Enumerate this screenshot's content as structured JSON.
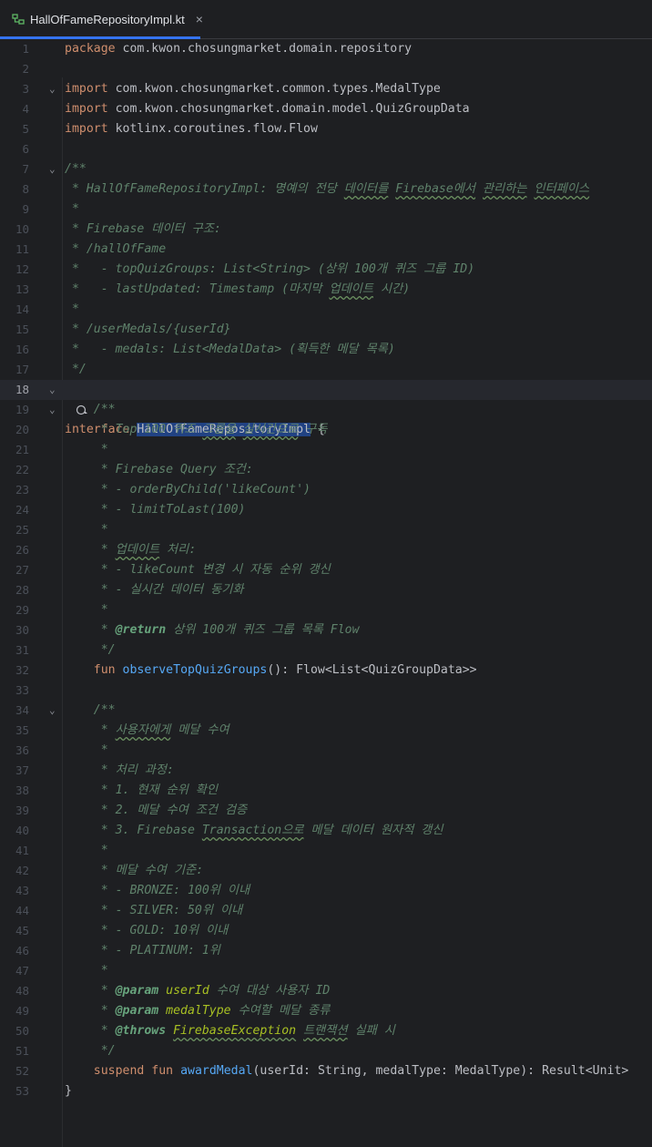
{
  "tab": {
    "title": "HallOfFameRepositoryImpl.kt",
    "close": "×"
  },
  "lines": [
    {
      "n": "1"
    },
    {
      "n": "2"
    },
    {
      "n": "3"
    },
    {
      "n": "4"
    },
    {
      "n": "5"
    },
    {
      "n": "6"
    },
    {
      "n": "7"
    },
    {
      "n": "8"
    },
    {
      "n": "9"
    },
    {
      "n": "10"
    },
    {
      "n": "11"
    },
    {
      "n": "12"
    },
    {
      "n": "13"
    },
    {
      "n": "14"
    },
    {
      "n": "15"
    },
    {
      "n": "16"
    },
    {
      "n": "17"
    },
    {
      "n": "18"
    },
    {
      "n": "19"
    },
    {
      "n": "20"
    },
    {
      "n": "21"
    },
    {
      "n": "22"
    },
    {
      "n": "23"
    },
    {
      "n": "24"
    },
    {
      "n": "25"
    },
    {
      "n": "26"
    },
    {
      "n": "27"
    },
    {
      "n": "28"
    },
    {
      "n": "29"
    },
    {
      "n": "30"
    },
    {
      "n": "31"
    },
    {
      "n": "32"
    },
    {
      "n": "33"
    },
    {
      "n": "34"
    },
    {
      "n": "35"
    },
    {
      "n": "36"
    },
    {
      "n": "37"
    },
    {
      "n": "38"
    },
    {
      "n": "39"
    },
    {
      "n": "40"
    },
    {
      "n": "41"
    },
    {
      "n": "42"
    },
    {
      "n": "43"
    },
    {
      "n": "44"
    },
    {
      "n": "45"
    },
    {
      "n": "46"
    },
    {
      "n": "47"
    },
    {
      "n": "48"
    },
    {
      "n": "49"
    },
    {
      "n": "50"
    },
    {
      "n": "51"
    },
    {
      "n": "52"
    },
    {
      "n": "53"
    }
  ],
  "code": {
    "l1_kw": "package",
    "l1_rest": " com.kwon.chosungmarket.domain.repository",
    "l3_kw": "import",
    "l3_rest": " com.kwon.chosungmarket.common.types.MedalType",
    "l4_kw": "import",
    "l4_rest": " com.kwon.chosungmarket.domain.model.QuizGroupData",
    "l5_kw": "import",
    "l5_rest": " kotlinx.coroutines.flow.Flow",
    "l7": "/**",
    "l8a": " * HallOfFameRepositoryImpl: 명예의 전당 ",
    "l8b": "데이터를",
    "l8c": " ",
    "l8d": "Firebase에서",
    "l8e": " ",
    "l8f": "관리하는",
    "l8g": " ",
    "l8h": "인터페이스",
    "l9": " *",
    "l10": " * Firebase 데이터 구조:",
    "l11": " * /hallOfFame",
    "l12": " *   - topQuizGroups: List<String> (상위 100개 퀴즈 그룹 ID)",
    "l13a": " *   - lastUpdated: Timestamp (마지막 ",
    "l13b": "업데이트",
    "l13c": " 시간)",
    "l14": " *",
    "l15": " * /userMedals/{userId}",
    "l16": " *   - medals: List<MedalData> (획득한 메달 목록)",
    "l17": " */",
    "l18_kw": "interface",
    "l18_sp": " ",
    "l18_name": "HallOfFameRepositoryImpl",
    "l18_rest": " {",
    "l19": "    /**",
    "l20a": "     * Top 100 퀴즈 ",
    "l20b": "그룹을",
    "l20c": " ",
    "l20d": "실시간으로",
    "l20e": " 구독",
    "l21": "     *",
    "l22": "     * Firebase Query 조건:",
    "l23": "     * - orderByChild('likeCount')",
    "l24": "     * - limitToLast(100)",
    "l25": "     *",
    "l26a": "     * ",
    "l26b": "업데이트",
    "l26c": " 처리:",
    "l27": "     * - likeCount 변경 시 자동 순위 갱신",
    "l28": "     * - 실시간 데이터 동기화",
    "l29": "     *",
    "l30a": "     * ",
    "l30tag": "@return",
    "l30b": " 상위 100개 퀴즈 그룹 목록 Flow",
    "l31": "     */",
    "l32_indent": "    ",
    "l32_kw": "fun",
    "l32_sp": " ",
    "l32_fn": "observeTopQuizGroups",
    "l32_rest": "(): Flow<List<QuizGroupData>>",
    "l34": "    /**",
    "l35a": "     * ",
    "l35b": "사용자에게",
    "l35c": " 메달 수여",
    "l36": "     *",
    "l37": "     * 처리 과정:",
    "l38": "     * 1. 현재 순위 확인",
    "l39": "     * 2. 메달 수여 조건 검증",
    "l40a": "     * 3. Firebase ",
    "l40b": "Transaction으로",
    "l40c": " 메달 데이터 원자적 갱신",
    "l41": "     *",
    "l42": "     * 메달 수여 기준:",
    "l43": "     * - BRONZE: 100위 이내",
    "l44": "     * - SILVER: 50위 이내",
    "l45": "     * - GOLD: 10위 이내",
    "l46": "     * - PLATINUM: 1위",
    "l47": "     *",
    "l48a": "     * ",
    "l48tag": "@param",
    "l48p": " userId",
    "l48b": " 수여 대상 사용자 ID",
    "l49a": "     * ",
    "l49tag": "@param",
    "l49p": " medalType",
    "l49b": " 수여할 메달 종류",
    "l50a": "     * ",
    "l50tag": "@throws",
    "l50sp": " ",
    "l50p": "FirebaseException",
    "l50b": " ",
    "l50c": "트랜잭션",
    "l50d": " 실패 시",
    "l51": "     */",
    "l52_indent": "    ",
    "l52_kw1": "suspend",
    "l52_sp1": " ",
    "l52_kw2": "fun",
    "l52_sp2": " ",
    "l52_fn": "awardMedal",
    "l52_rest": "(userId: String, medalType: MedalType): Result<Unit>",
    "l53": "}"
  },
  "colors": {
    "accent": "#3574f0",
    "background": "#1e1f22",
    "keyword": "#cf8e6d",
    "comment": "#5f826b",
    "function": "#56a8f5"
  },
  "icons": {
    "tab": "kotlin-interface-file-icon",
    "marker": "implemented-interface-icon"
  }
}
